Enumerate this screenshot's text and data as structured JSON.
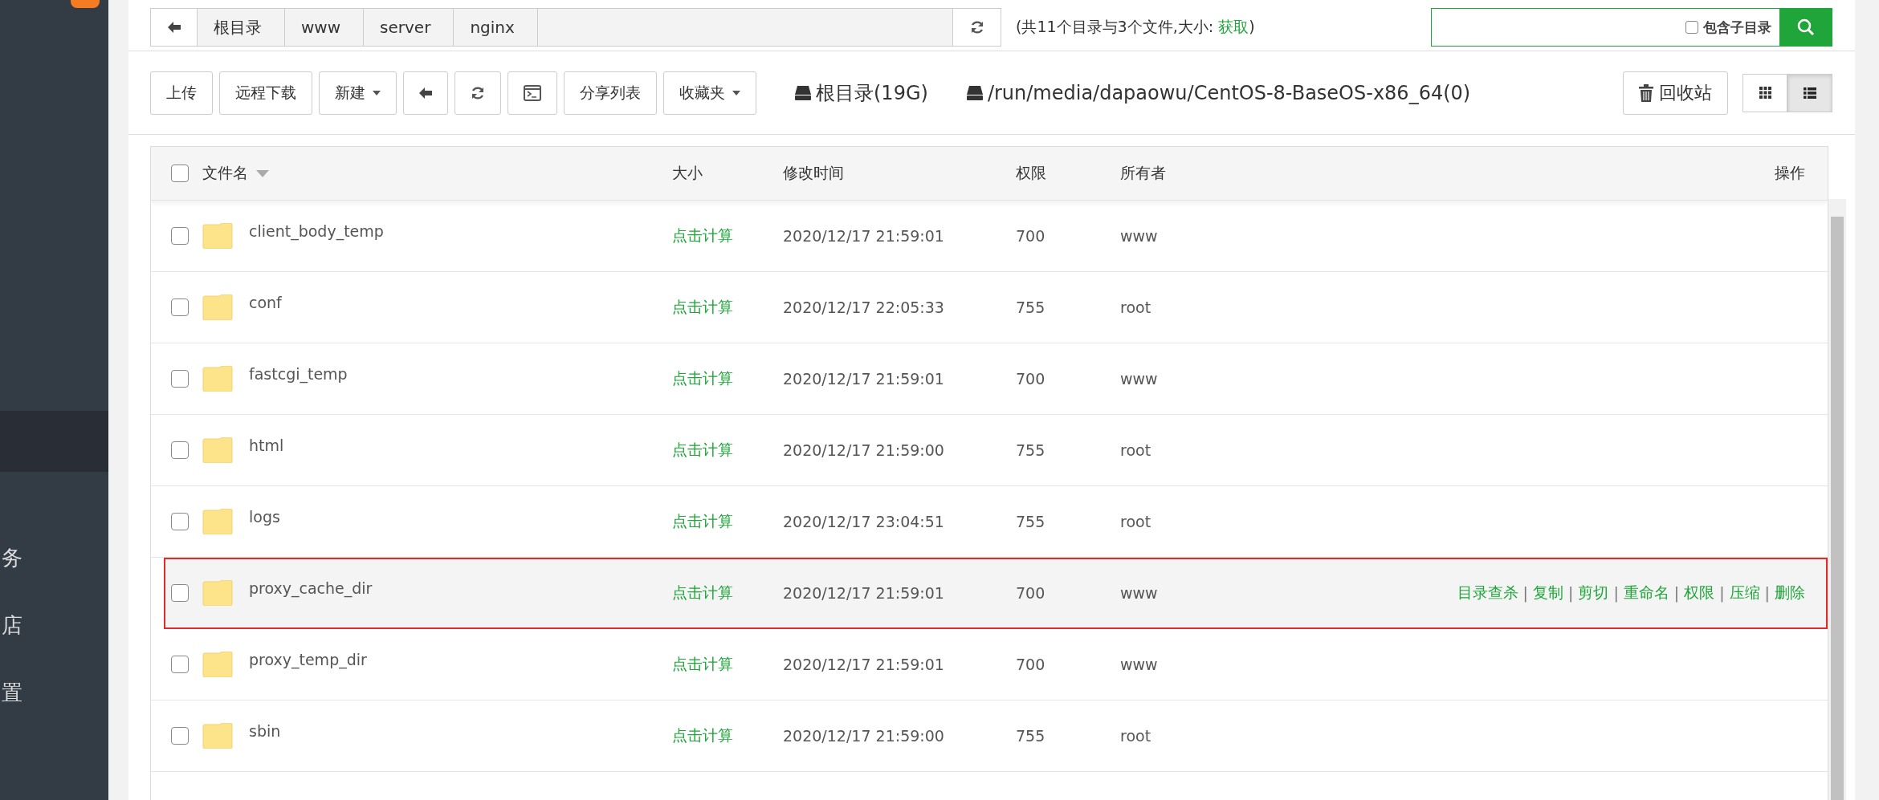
{
  "sidebar": {
    "items": [
      {
        "label": "务",
        "selected": false
      },
      {
        "label": "店",
        "selected": false
      },
      {
        "label": "置",
        "selected": false
      }
    ]
  },
  "breadcrumb": [
    "根目录",
    "www",
    "server",
    "nginx"
  ],
  "summary": {
    "text": "(共11个目录与3个文件,大小: ",
    "link": "获取",
    "close": ")"
  },
  "search": {
    "checkbox_label": "包含子目录",
    "checked": false
  },
  "toolbar": [
    {
      "kind": "text",
      "label": "上传"
    },
    {
      "kind": "text",
      "label": "远程下载"
    },
    {
      "kind": "dropdown",
      "label": "新建"
    },
    {
      "kind": "back"
    },
    {
      "kind": "refresh"
    },
    {
      "kind": "terminal"
    },
    {
      "kind": "text",
      "label": "分享列表"
    },
    {
      "kind": "dropdown",
      "label": "收藏夹"
    }
  ],
  "disks": [
    "根目录(19G)",
    "/run/media/dapaowu/CentOS-8-BaseOS-x86_64(0)"
  ],
  "recycle": "回收站",
  "view_modes": [
    {
      "kind": "grid",
      "selected": false
    },
    {
      "kind": "list",
      "selected": true
    }
  ],
  "table": {
    "select_all_checked": false,
    "columns": [
      "文件名",
      "大小",
      "修改时间",
      "权限",
      "所有者",
      "操作"
    ],
    "rows": [
      {
        "name": "client_body_temp",
        "size": "点击计算",
        "modified": "2020/12/17 21:59:01",
        "perm": "700",
        "owner": "www",
        "hovered": false
      },
      {
        "name": "conf",
        "size": "点击计算",
        "modified": "2020/12/17 22:05:33",
        "perm": "755",
        "owner": "root",
        "hovered": false
      },
      {
        "name": "fastcgi_temp",
        "size": "点击计算",
        "modified": "2020/12/17 21:59:01",
        "perm": "700",
        "owner": "www",
        "hovered": false
      },
      {
        "name": "html",
        "size": "点击计算",
        "modified": "2020/12/17 21:59:00",
        "perm": "755",
        "owner": "root",
        "hovered": false
      },
      {
        "name": "logs",
        "size": "点击计算",
        "modified": "2020/12/17 23:04:51",
        "perm": "755",
        "owner": "root",
        "hovered": false
      },
      {
        "name": "proxy_cache_dir",
        "size": "点击计算",
        "modified": "2020/12/17 21:59:01",
        "perm": "700",
        "owner": "www",
        "hovered": true,
        "actions": [
          {
            "kind": "link",
            "label": "目录查杀"
          },
          {
            "kind": "separator",
            "label": "|"
          },
          {
            "kind": "link",
            "label": "复制"
          },
          {
            "kind": "separator",
            "label": "|"
          },
          {
            "kind": "link",
            "label": "剪切"
          },
          {
            "kind": "separator",
            "label": "|"
          },
          {
            "kind": "link",
            "label": "重命名"
          },
          {
            "kind": "separator",
            "label": "|"
          },
          {
            "kind": "link",
            "label": "权限"
          },
          {
            "kind": "separator",
            "label": "|"
          },
          {
            "kind": "link",
            "label": "压缩"
          },
          {
            "kind": "separator",
            "label": "|"
          },
          {
            "kind": "link",
            "label": "删除"
          }
        ]
      },
      {
        "name": "proxy_temp_dir",
        "size": "点击计算",
        "modified": "2020/12/17 21:59:01",
        "perm": "700",
        "owner": "www",
        "hovered": false
      },
      {
        "name": "sbin",
        "size": "点击计算",
        "modified": "2020/12/17 21:59:00",
        "perm": "755",
        "owner": "root",
        "hovered": false
      }
    ]
  }
}
